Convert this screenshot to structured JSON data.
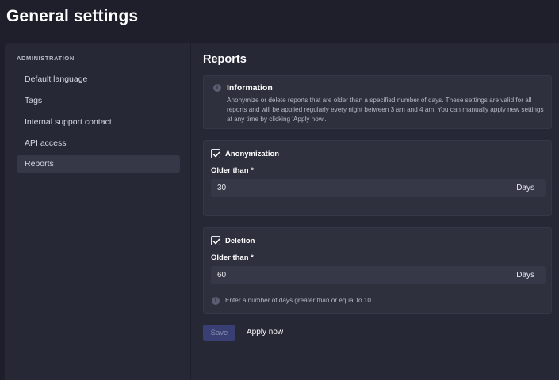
{
  "page": {
    "title": "General settings"
  },
  "sidebar": {
    "heading": "ADMINISTRATION",
    "items": [
      {
        "label": "Default language"
      },
      {
        "label": "Tags"
      },
      {
        "label": "Internal support contact"
      },
      {
        "label": "API access"
      },
      {
        "label": "Reports",
        "active": true
      }
    ]
  },
  "main": {
    "title": "Reports",
    "info": {
      "icon": "info-icon",
      "title": "Information",
      "body": "Anonymize or delete reports that are older than a specified number of days. These settings are valid for all reports and will be applied regularly every night between 3 am and 4 am. You can manually apply new settings at any time by clicking 'Apply now'."
    },
    "anonymization": {
      "checked": true,
      "label": "Anonymization",
      "field_label": "Older than *",
      "value": "30",
      "unit": "Days"
    },
    "deletion": {
      "checked": true,
      "label": "Deletion",
      "field_label": "Older than *",
      "value": "60",
      "unit": "Days",
      "hint": "Enter a number of days greater than or equal to 10."
    },
    "actions": {
      "save_label": "Save",
      "apply_label": "Apply now"
    }
  },
  "colors": {
    "background": "#1e1f2a",
    "panel": "#262835",
    "card": "#2e303d",
    "input": "#363847",
    "primary_disabled": "#3a3f73"
  }
}
